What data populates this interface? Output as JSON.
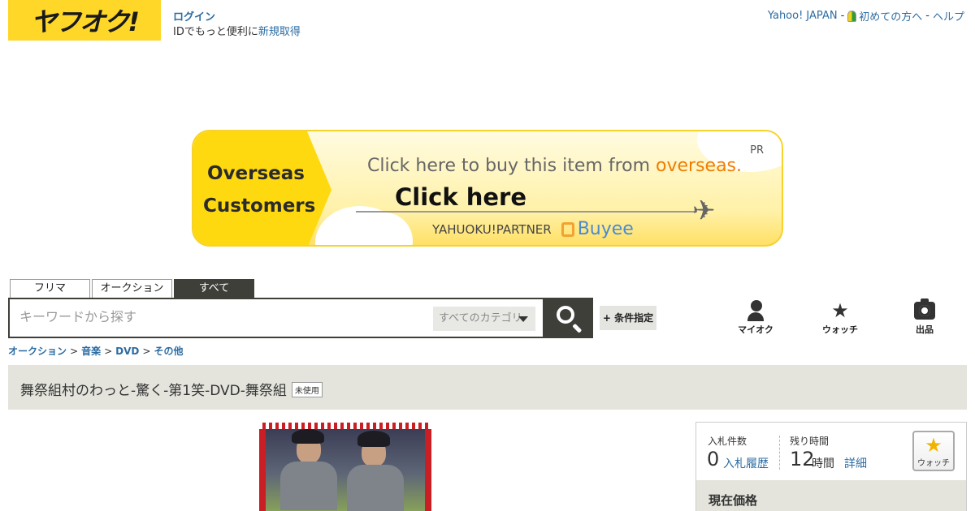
{
  "header": {
    "logo": "ヤフオク!",
    "login": "ログイン",
    "id_prefix": "IDでもっと便利に",
    "id_link": "新規取得",
    "top_links": {
      "yahoo": "Yahoo! JAPAN",
      "sep1": "-",
      "beginner": "初めての方へ",
      "sep2": "-",
      "help": "ヘルプ"
    }
  },
  "banner": {
    "left_line1": "Overseas",
    "left_line2": "Customers",
    "pr": "PR",
    "headline": "Click here to buy this item from ",
    "headline_accent": "overseas.",
    "click": "Click here",
    "partner": "YAHUOKU!PARTNER",
    "buyee": "Buyee",
    "accent_color": "#f07d00"
  },
  "tabs": [
    {
      "label": "フリマ"
    },
    {
      "label": "オークション"
    },
    {
      "label": "すべて",
      "active": true
    }
  ],
  "search": {
    "placeholder": "キーワードから探す",
    "category": "すべてのカテゴリ",
    "condition": "+ 条件指定"
  },
  "nav": {
    "myauc": "マイオク",
    "watch": "ウォッチ",
    "sell": "出品"
  },
  "breadcrumb": {
    "items": [
      "オークション",
      "音楽",
      "DVD",
      "その他"
    ],
    "separator": ">"
  },
  "item": {
    "title": "舞祭組村のわっと-驚く-第1笑-DVD-舞祭組",
    "condition_badge": "未使用"
  },
  "panel": {
    "bids_label": "入札件数",
    "bids_value": "0",
    "bids_link": "入札履歴",
    "time_label": "残り時間",
    "time_value": "12",
    "time_unit": "時間",
    "time_link": "詳細",
    "watch_label": "ウォッチ",
    "price_title": "現在価格"
  }
}
